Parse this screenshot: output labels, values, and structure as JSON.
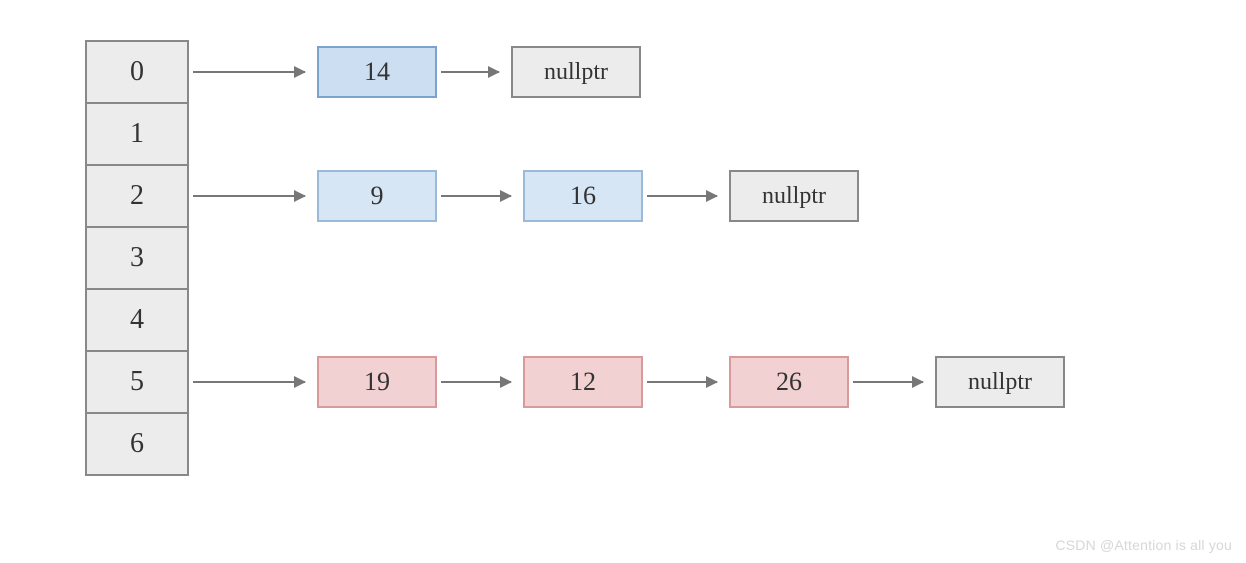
{
  "buckets": [
    "0",
    "1",
    "2",
    "3",
    "4",
    "5",
    "6"
  ],
  "rows": {
    "r0": {
      "nodes": [
        "14"
      ],
      "terminal": "nullptr"
    },
    "r2": {
      "nodes": [
        "9",
        "16"
      ],
      "terminal": "nullptr"
    },
    "r5": {
      "nodes": [
        "19",
        "12",
        "26"
      ],
      "terminal": "nullptr"
    }
  },
  "colors": {
    "bucket_fill": "#ececec",
    "blue_fill": "#d7e6f4",
    "blue_dark_fill": "#ccdff2",
    "pink_fill": "#f1d1d1",
    "arrow": "#777777"
  },
  "watermark": "CSDN @Attention is all you"
}
